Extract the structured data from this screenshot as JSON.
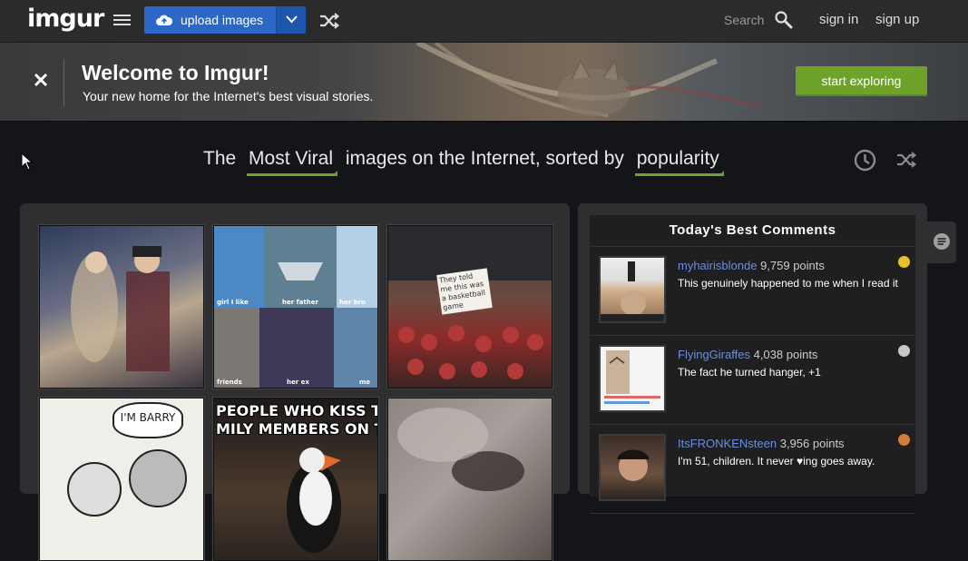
{
  "nav": {
    "logo": "imgur",
    "upload_label": "upload images",
    "search_label": "Search",
    "signin": "sign in",
    "signup": "sign up"
  },
  "banner": {
    "title": "Welcome to Imgur!",
    "subtitle": "Your new home for the Internet's best visual stories.",
    "cta": "start exploring"
  },
  "headline": {
    "prefix": "The",
    "section": "Most Viral",
    "middle": "images on the Internet, sorted by",
    "sort": "popularity"
  },
  "gallery": {
    "thumbs": [
      {
        "icon": "photo-thumbnail"
      },
      {
        "captions": [
          "girl I like",
          "her father",
          "her bro",
          "friends",
          "her ex",
          "me"
        ]
      },
      {
        "sign": "They told me this was a basketball game"
      },
      {
        "bubble": "I'M BARRY"
      },
      {
        "meme_line1": "PEOPLE WHO KISS THEIR",
        "meme_line2": "MILY MEMBERS ON THE LI"
      },
      {
        "icon": "photo-thumbnail"
      }
    ]
  },
  "comments": {
    "title": "Today's Best Comments",
    "items": [
      {
        "user": "myhairisblonde",
        "points": "9,759 points",
        "text": "This genuinely happened to me when I read it",
        "medal": "#e5c12c"
      },
      {
        "user": "FlyingGiraffes",
        "points": "4,038 points",
        "text": "The fact he turned hanger, +1",
        "medal": "#c8c8c8"
      },
      {
        "user": "ItsFRONKENsteen",
        "points": "3,956 points",
        "text": "I'm 51, children. It never ♥ing goes away.",
        "medal": "#d27c3a"
      }
    ]
  },
  "colors": {
    "accent_green": "#6ea22b",
    "upload_blue": "#2b67c6",
    "username_blue": "#6b8fd6"
  }
}
